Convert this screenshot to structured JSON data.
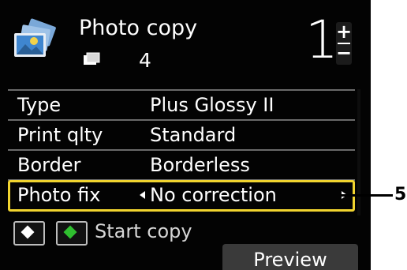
{
  "header": {
    "title": "Photo copy",
    "app_icon": "photo-stack-icon",
    "paper_icon": "paper-sheet-icon",
    "paper_count": "4",
    "copies": "1",
    "copies_plus": "+",
    "copies_minus": "−"
  },
  "settings": [
    {
      "label": "Type",
      "value": "Plus Glossy II"
    },
    {
      "label": "Print qlty",
      "value": "Standard"
    },
    {
      "label": "Border",
      "value": "Borderless"
    },
    {
      "label": "Photo fix",
      "value": "No correction",
      "selected": true
    }
  ],
  "footer": {
    "mono_button_icon": "black-start-icon",
    "color_button_icon": "color-start-icon",
    "start_label": "Start copy",
    "preview_label": "Preview"
  },
  "annotation": {
    "callout_number": "5"
  },
  "colors": {
    "screen_background": "#030303",
    "selection_highlight": "#f1d42f",
    "color_start": "#2fbf2f"
  }
}
